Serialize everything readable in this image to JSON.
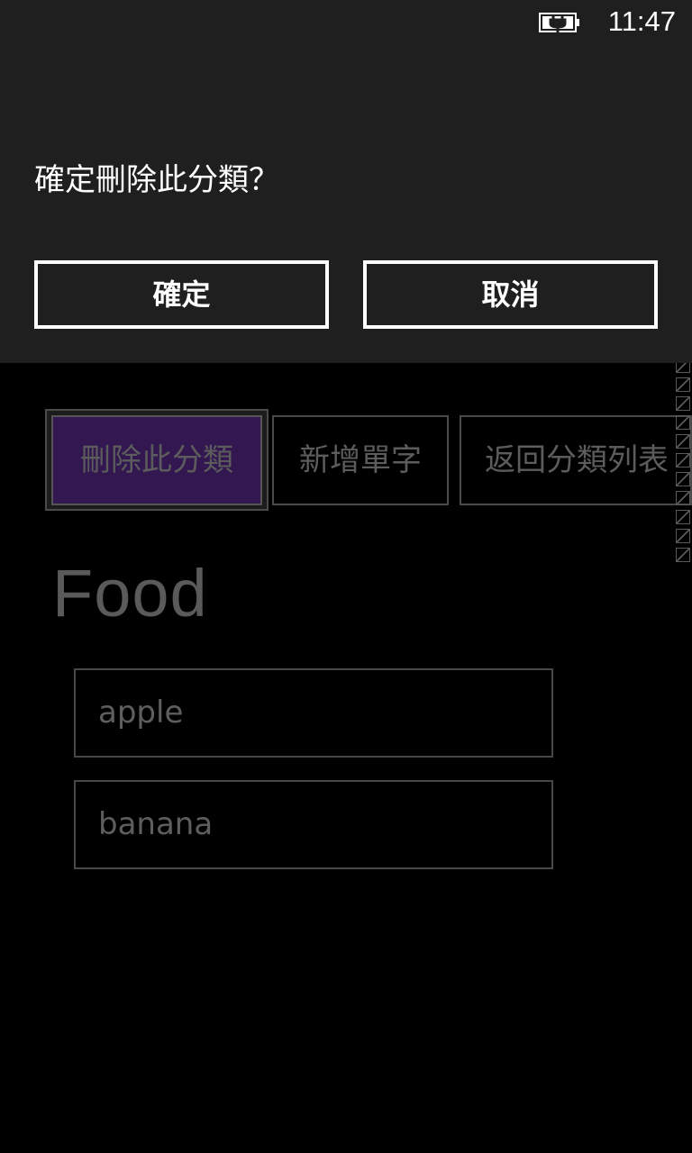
{
  "status_bar": {
    "time": "11:47",
    "battery_icon": "battery-charging-icon"
  },
  "dialog": {
    "message": "確定刪除此分類？",
    "confirm_label": "確定",
    "cancel_label": "取消"
  },
  "toolbar": {
    "delete_category_label": "刪除此分類",
    "add_word_label": "新增單字",
    "back_to_list_label": "返回分類列表"
  },
  "category": {
    "title": "Food",
    "words": [
      "apple",
      "banana"
    ]
  },
  "colors": {
    "dialog_background": "#1f1f1f",
    "accent_selected": "#321750",
    "page_background": "#000000"
  }
}
